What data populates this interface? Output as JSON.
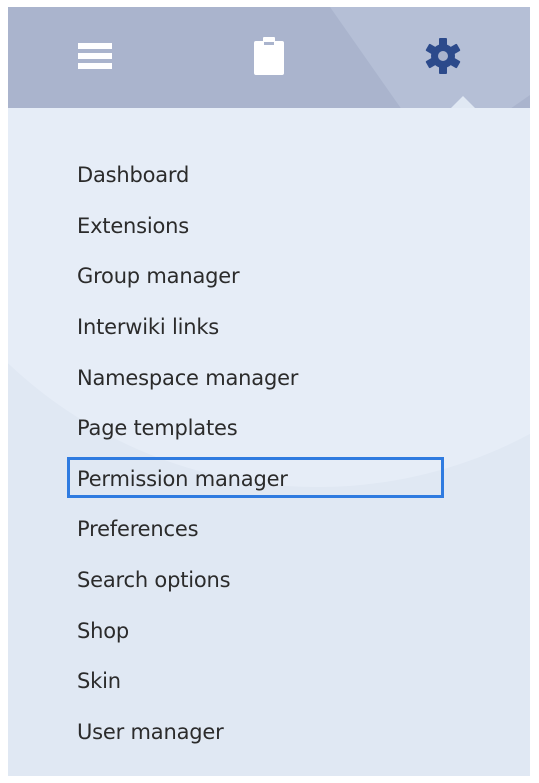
{
  "toolbar": {
    "tabs": [
      {
        "id": "list",
        "icon": "hamburger-menu-icon"
      },
      {
        "id": "clipboard",
        "icon": "clipboard-icon"
      },
      {
        "id": "settings",
        "icon": "gear-icon",
        "active": true
      }
    ],
    "colors": {
      "toolbar_bg": "#aab4cd",
      "icon_light": "#ffffff",
      "icon_active": "#2c4a8b"
    }
  },
  "menu": {
    "items": [
      {
        "label": "Dashboard"
      },
      {
        "label": "Extensions"
      },
      {
        "label": "Group manager"
      },
      {
        "label": "Interwiki links"
      },
      {
        "label": "Namespace manager"
      },
      {
        "label": "Page templates"
      },
      {
        "label": "Permission manager",
        "highlighted": true
      },
      {
        "label": "Preferences"
      },
      {
        "label": "Search options"
      },
      {
        "label": "Shop"
      },
      {
        "label": "Skin"
      },
      {
        "label": "User manager"
      }
    ],
    "highlight_color": "#2f7be0"
  }
}
